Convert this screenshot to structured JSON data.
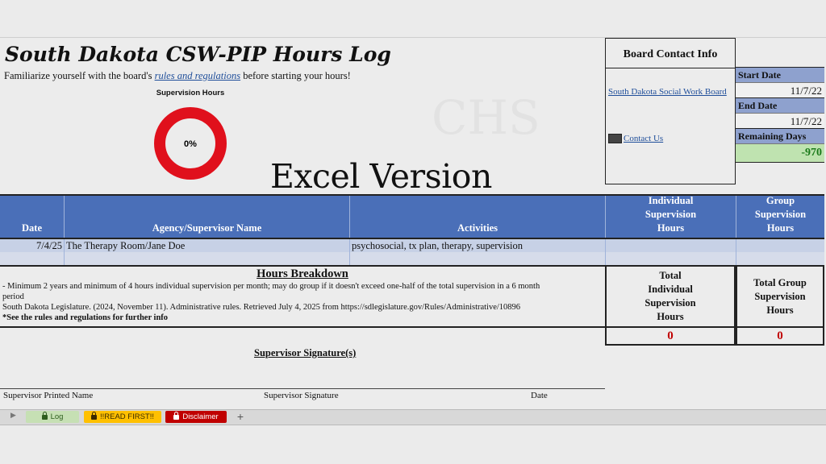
{
  "header": {
    "title": "South Dakota CSW-PIP Hours Log",
    "subtitle_prefix": "Familiarize yourself with the board's ",
    "subtitle_link": "rules and regulations",
    "subtitle_suffix": " before starting your hours!",
    "overlay_text": "Excel Version",
    "watermark": "CHS"
  },
  "donut": {
    "title": "Supervision Hours",
    "value_label": "0%",
    "percent": 0,
    "ring_color": "#e0101c"
  },
  "contact": {
    "heading": "Board Contact Info",
    "board_link": "South Dakota Social Work Board",
    "contact_link": "Contact Us"
  },
  "dates": {
    "start_label": "Start Date",
    "start_value": "11/7/22",
    "end_label": "End Date",
    "end_value": "11/7/22",
    "remaining_label": "Remaining Days",
    "remaining_value": "-970"
  },
  "table": {
    "headers": [
      "Date",
      "Agency/Supervisor Name",
      "Activities",
      "Individual Supervision Hours",
      "Group Supervision Hours"
    ],
    "rows": [
      {
        "date": "7/4/25",
        "agency": "The Therapy Room/Jane Doe",
        "activities": "psychosocial, tx plan, therapy, supervision",
        "individual": "",
        "group": ""
      }
    ]
  },
  "breakdown": {
    "title": "Hours Breakdown",
    "line1": "- Minimum 2 years and minimum of 4 hours individual supervision per month; may do group if it doesn't exceed one-half of the total supervision in a 6 month",
    "line1b": "period",
    "line2": "South Dakota Legislature. (2024, November 11). Administrative rules. Retrieved July 4, 2025 from https://sdlegislature.gov/Rules/Administrative/10896",
    "line3": "*See the rules and regulations for further info"
  },
  "totals": {
    "individual_label": "Total Individual Supervision Hours",
    "individual_value": "0",
    "group_label": "Total Group Supervision Hours",
    "group_value": "0"
  },
  "signature": {
    "title": "Supervisor Signature(s)",
    "printed_name": "Supervisor Printed Name",
    "signature": "Supervisor Signature",
    "date": "Date"
  },
  "tabs": [
    {
      "label": "Log",
      "color": "#c6e0b4"
    },
    {
      "label": "!!READ FIRST!!",
      "color": "#ffc000"
    },
    {
      "label": "Disclaimer",
      "color": "#c00000"
    }
  ],
  "add_sheet": "+"
}
